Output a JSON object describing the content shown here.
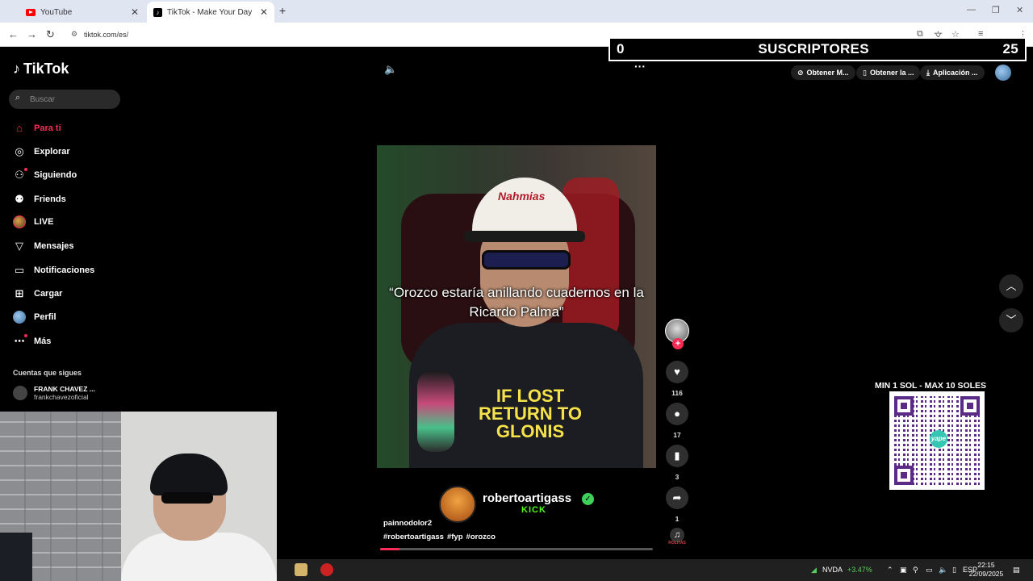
{
  "browser": {
    "tabs": [
      {
        "title": "YouTube",
        "active": false
      },
      {
        "title": "TikTok - Make Your Day",
        "active": true
      }
    ],
    "new_tab": "+",
    "url": "tiktok.com/es/"
  },
  "overlay": {
    "subs_left": "0",
    "subs_label": "SUSCRIPTORES",
    "subs_right": "25"
  },
  "sidebar": {
    "logo": "TikTok",
    "search_placeholder": "Buscar",
    "items": [
      {
        "label": "Para ti",
        "icon": "home-icon"
      },
      {
        "label": "Explorar",
        "icon": "compass-icon"
      },
      {
        "label": "Siguiendo",
        "icon": "user-follow-icon"
      },
      {
        "label": "Friends",
        "icon": "friends-icon"
      },
      {
        "label": "LIVE",
        "icon": "live-icon"
      },
      {
        "label": "Mensajes",
        "icon": "send-icon"
      },
      {
        "label": "Notificaciones",
        "icon": "notification-icon"
      },
      {
        "label": "Cargar",
        "icon": "upload-icon"
      },
      {
        "label": "Perfil",
        "icon": "profile-icon"
      },
      {
        "label": "Más",
        "icon": "more-icon"
      }
    ],
    "following_header": "Cuentas que sigues",
    "following": [
      {
        "name": "FRANK CHAVEZ ...",
        "handle": "frankchavezoficial"
      }
    ]
  },
  "topbar": {
    "pills": [
      {
        "label": "Obtener M...",
        "icon": "coin-icon"
      },
      {
        "label": "Obtener la ...",
        "icon": "phone-icon"
      },
      {
        "label": "Aplicación ...",
        "icon": "download-icon"
      }
    ]
  },
  "video": {
    "caption": "“Orozco estaría anillando cuadernos en la Ricardo Palma”",
    "cap_text": "Nahmias",
    "shirt_text": "IF LOST RETURN TO GLONIS",
    "progress": 0.07,
    "creator": "robertoartigass",
    "creator_badge": "KICK",
    "description": "painnodolor2",
    "tags": [
      "#robertoartigass",
      "#fyp",
      "#orozco"
    ]
  },
  "actions": {
    "likes": "116",
    "comments": "17",
    "saves": "3",
    "shares": "1",
    "music_label": "ROLITAS"
  },
  "qr": {
    "title": "MIN 1 SOL - MAX 10 SOLES",
    "brand": "yape"
  },
  "taskbar": {
    "stock_name": "NVDA",
    "stock_change": "+3.47%",
    "lang": "ESP",
    "time": "22:15",
    "date": "22/09/2025"
  },
  "colors": {
    "tiktok_red": "#fe2c55",
    "kick_green": "#53fc18",
    "verified_green": "#3fd25b",
    "yape_purple": "#5b2a86"
  }
}
